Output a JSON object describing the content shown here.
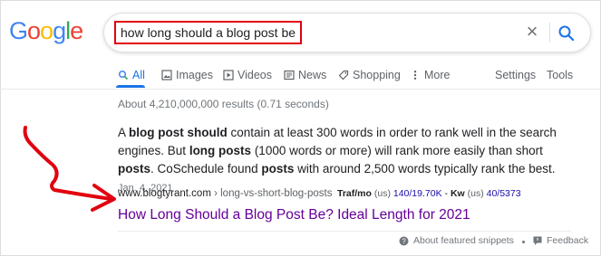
{
  "logo": {
    "text": "Google",
    "letters": [
      "G",
      "o",
      "o",
      "g",
      "l",
      "e"
    ],
    "colors": [
      "#4285f4",
      "#ea4335",
      "#fbbc05",
      "#4285f4",
      "#34a853",
      "#ea4335"
    ]
  },
  "search": {
    "query": "how long should a blog post be",
    "clear_icon": "close-icon",
    "submit_icon": "search-icon"
  },
  "tabs": [
    {
      "label": "All",
      "icon": "search-icon",
      "active": true
    },
    {
      "label": "Images",
      "icon": "image-icon"
    },
    {
      "label": "Videos",
      "icon": "video-icon"
    },
    {
      "label": "News",
      "icon": "news-icon"
    },
    {
      "label": "Shopping",
      "icon": "tag-icon"
    },
    {
      "label": "More",
      "icon": "more-icon"
    }
  ],
  "tools": {
    "settings": "Settings",
    "tools": "Tools"
  },
  "results_stats": "About 4,210,000,000 results (0.71 seconds)",
  "snippet": {
    "parts": [
      {
        "t": "A ",
        "b": false
      },
      {
        "t": "blog post should",
        "b": true
      },
      {
        "t": " contain at least 300 words in order to rank well in the search engines. But ",
        "b": false
      },
      {
        "t": "long posts",
        "b": true
      },
      {
        "t": " (1000 words or more) will rank more easily than short ",
        "b": false
      },
      {
        "t": "posts",
        "b": true
      },
      {
        "t": ". CoSchedule found ",
        "b": false
      },
      {
        "t": "posts",
        "b": true
      },
      {
        "t": " with around 2,500 words typically rank the best.",
        "b": false
      }
    ],
    "date": "Jan. 4, 2021"
  },
  "result": {
    "domain": "www.blogtyrant.com",
    "path": " › long-vs-short-blog-posts",
    "title": "How Long Should a Blog Post Be? Ideal Length for 2021"
  },
  "metrics": {
    "traf_label": "Traf/mo",
    "traf_unit": "(us)",
    "traf_value": "140/19.70K",
    "sep": " - ",
    "kw_label": "Kw",
    "kw_unit": "(us)",
    "kw_value": "40/5373"
  },
  "footer": {
    "about": "About featured snippets",
    "feedback": "Feedback"
  },
  "annotation": {
    "arrow_color": "#e1000f",
    "box_color": "#e1000f"
  }
}
